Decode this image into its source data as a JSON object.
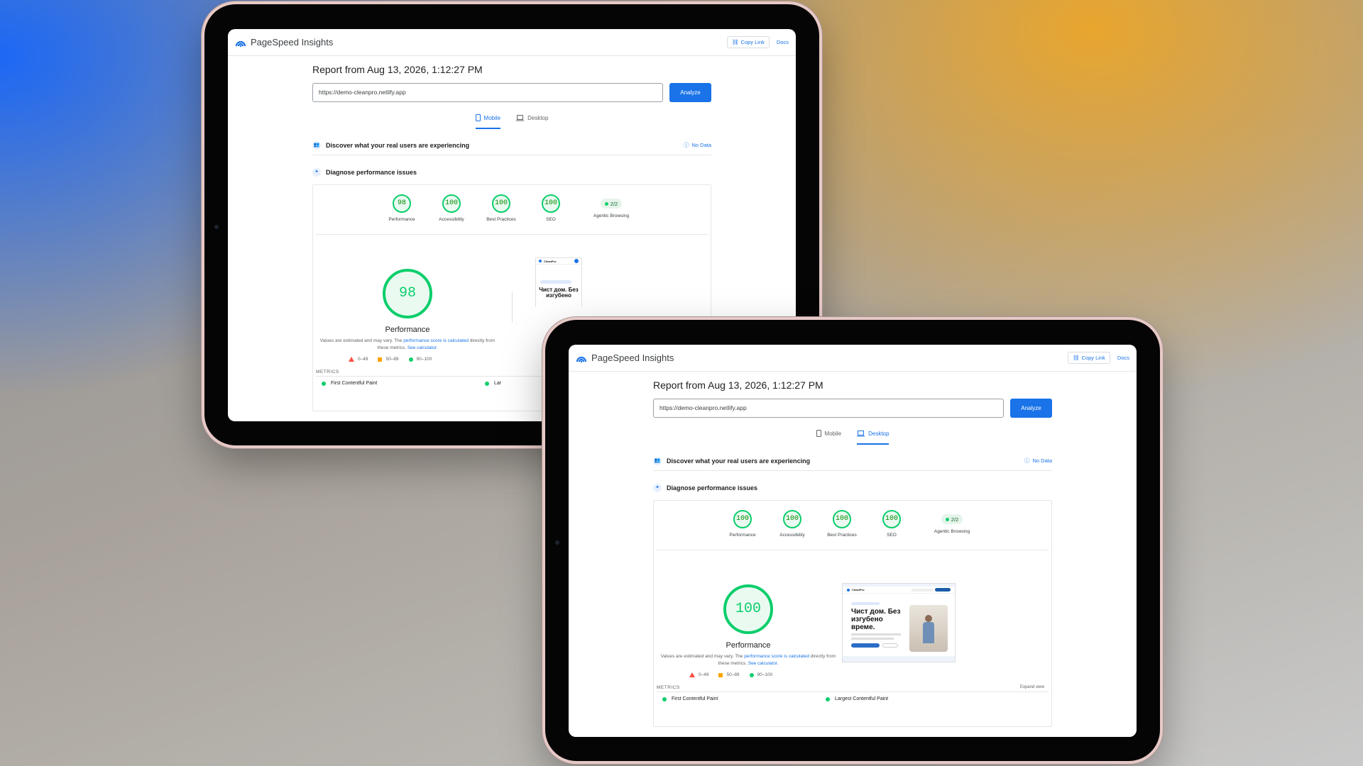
{
  "app": {
    "name": "PageSpeed Insights",
    "copy_link": "Copy Link",
    "docs": "Docs"
  },
  "report_title": "Report from Aug 13, 2026, 1:12:27 PM",
  "url_value": "https://demo-cleanpro.netlify.app",
  "analyze_label": "Analyze",
  "tabs": {
    "mobile": "Mobile",
    "desktop": "Desktop"
  },
  "real_users": {
    "text": "Discover what your real users are experiencing",
    "no_data": "No Data"
  },
  "diagnose": "Diagnose performance issues",
  "categories": {
    "performance": "Performance",
    "accessibility": "Accessibility",
    "best_practices": "Best Practices",
    "seo": "SEO",
    "agentic": "Agentic Browsing"
  },
  "mobile": {
    "active_tab": "mobile",
    "performance": "98",
    "accessibility": "100",
    "best_practices": "100",
    "seo": "100",
    "agentic": "2/2"
  },
  "desktop": {
    "active_tab": "desktop",
    "performance": "100",
    "accessibility": "100",
    "best_practices": "100",
    "seo": "100",
    "agentic": "2/2"
  },
  "perf_label": "Performance",
  "note": {
    "text_a": "Values are estimated and may vary. The ",
    "link_a": "performance score is calculated",
    "text_b": " directly from these metrics. ",
    "link_b": "See calculator."
  },
  "legend": {
    "bad": "0–49",
    "average": "50–89",
    "good": "90–100"
  },
  "metrics_label": "METRICS",
  "expand_view": "Expand view",
  "metrics": {
    "fcp": "First Contentful Paint",
    "lcp": "Largest Contentful Paint",
    "lcp_cut": "Lar"
  },
  "preview": {
    "brand": "CleanPro",
    "headline_mobile": "Чист дом. Без изгубено",
    "headline_desktop": "Чист дом. Без изгубено време."
  },
  "colors": {
    "accent": "#1a73e8",
    "pass": "#0cce6b",
    "average": "#ffa400",
    "fail": "#ff4e42"
  }
}
